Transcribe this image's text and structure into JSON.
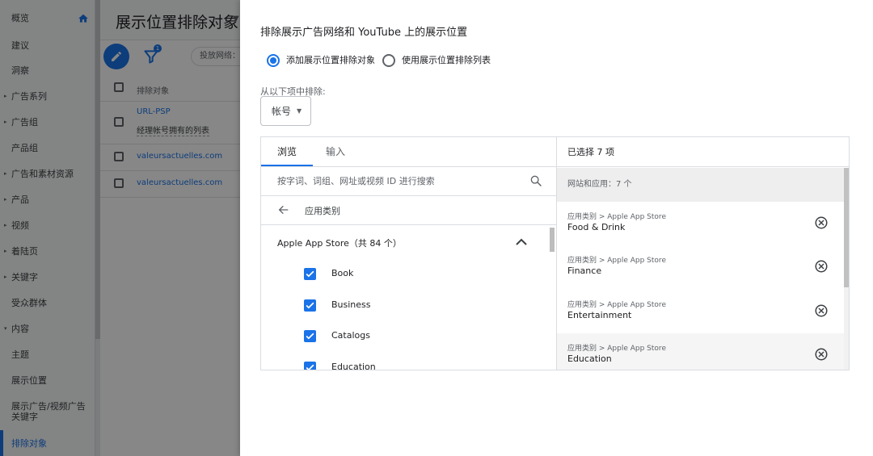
{
  "sidebar": {
    "items": [
      {
        "label": "概览"
      },
      {
        "label": "建议"
      },
      {
        "label": "洞察"
      },
      {
        "label": "广告系列"
      },
      {
        "label": "广告组"
      },
      {
        "label": "产品组"
      },
      {
        "label": "广告和素材资源"
      },
      {
        "label": "产品"
      },
      {
        "label": "视频"
      },
      {
        "label": "着陆页"
      },
      {
        "label": "关键字"
      },
      {
        "label": "受众群体"
      },
      {
        "label": "内容"
      },
      {
        "label": "主题"
      },
      {
        "label": "展示位置"
      },
      {
        "label": "展示广告/视频广告关键字"
      },
      {
        "label": "排除对象"
      }
    ]
  },
  "main": {
    "title": "展示位置排除对象",
    "filter_badge": "1",
    "network_chip": "投放网络：",
    "table": {
      "header": "排除对象",
      "rows": [
        {
          "line1": "URL-PSP",
          "line2": "经理帐号拥有的列表"
        },
        {
          "line1": "valeursactuelles.com"
        },
        {
          "line1": "valeursactuelles.com"
        }
      ]
    }
  },
  "panel": {
    "title": "排除展示广告网络和 YouTube 上的展示位置",
    "radios": [
      {
        "label": "添加展示位置排除对象",
        "selected": true
      },
      {
        "label": "使用展示位置排除列表",
        "selected": false
      }
    ],
    "exclude_from_label": "从以下项中排除:",
    "dropdown_value": "帐号",
    "tabs": [
      {
        "label": "浏览",
        "active": true
      },
      {
        "label": "输入",
        "active": false
      }
    ],
    "search_placeholder": "按字词、词组、网址或视频 ID 进行搜索",
    "breadcrumb": "应用类别",
    "group_title": "Apple App Store（共 84 个）",
    "categories": [
      {
        "label": "Book",
        "checked": true
      },
      {
        "label": "Business",
        "checked": true
      },
      {
        "label": "Catalogs",
        "checked": true
      },
      {
        "label": "Education",
        "checked": true
      }
    ],
    "selected_header": "已选择 7 项",
    "selected_group": "网站和应用：7 个",
    "selected_items": [
      {
        "path": "应用类别 > Apple App Store",
        "name": "Food & Drink"
      },
      {
        "path": "应用类别 > Apple App Store",
        "name": "Finance"
      },
      {
        "path": "应用类别 > Apple App Store",
        "name": "Entertainment"
      },
      {
        "path": "应用类别 > Apple App Store",
        "name": "Education"
      }
    ]
  },
  "colors": {
    "accent": "#1a73e8",
    "overlay": "#000000"
  }
}
